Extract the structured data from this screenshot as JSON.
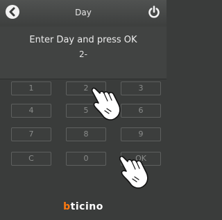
{
  "header": {
    "title": "Day",
    "back_icon": "back-arrow-icon",
    "power_icon": "power-icon"
  },
  "prompt": {
    "text": "Enter Day and press OK",
    "entry": "2-"
  },
  "keypad": {
    "keys": [
      "1",
      "2",
      "3",
      "4",
      "5",
      "6",
      "7",
      "8",
      "9",
      "C",
      "0",
      "OK"
    ]
  },
  "footer": {
    "logo_prefix": "b",
    "logo_rest": "ticino"
  },
  "colors": {
    "background": "#3a3c3b",
    "logo_accent": "#ff7a10"
  }
}
